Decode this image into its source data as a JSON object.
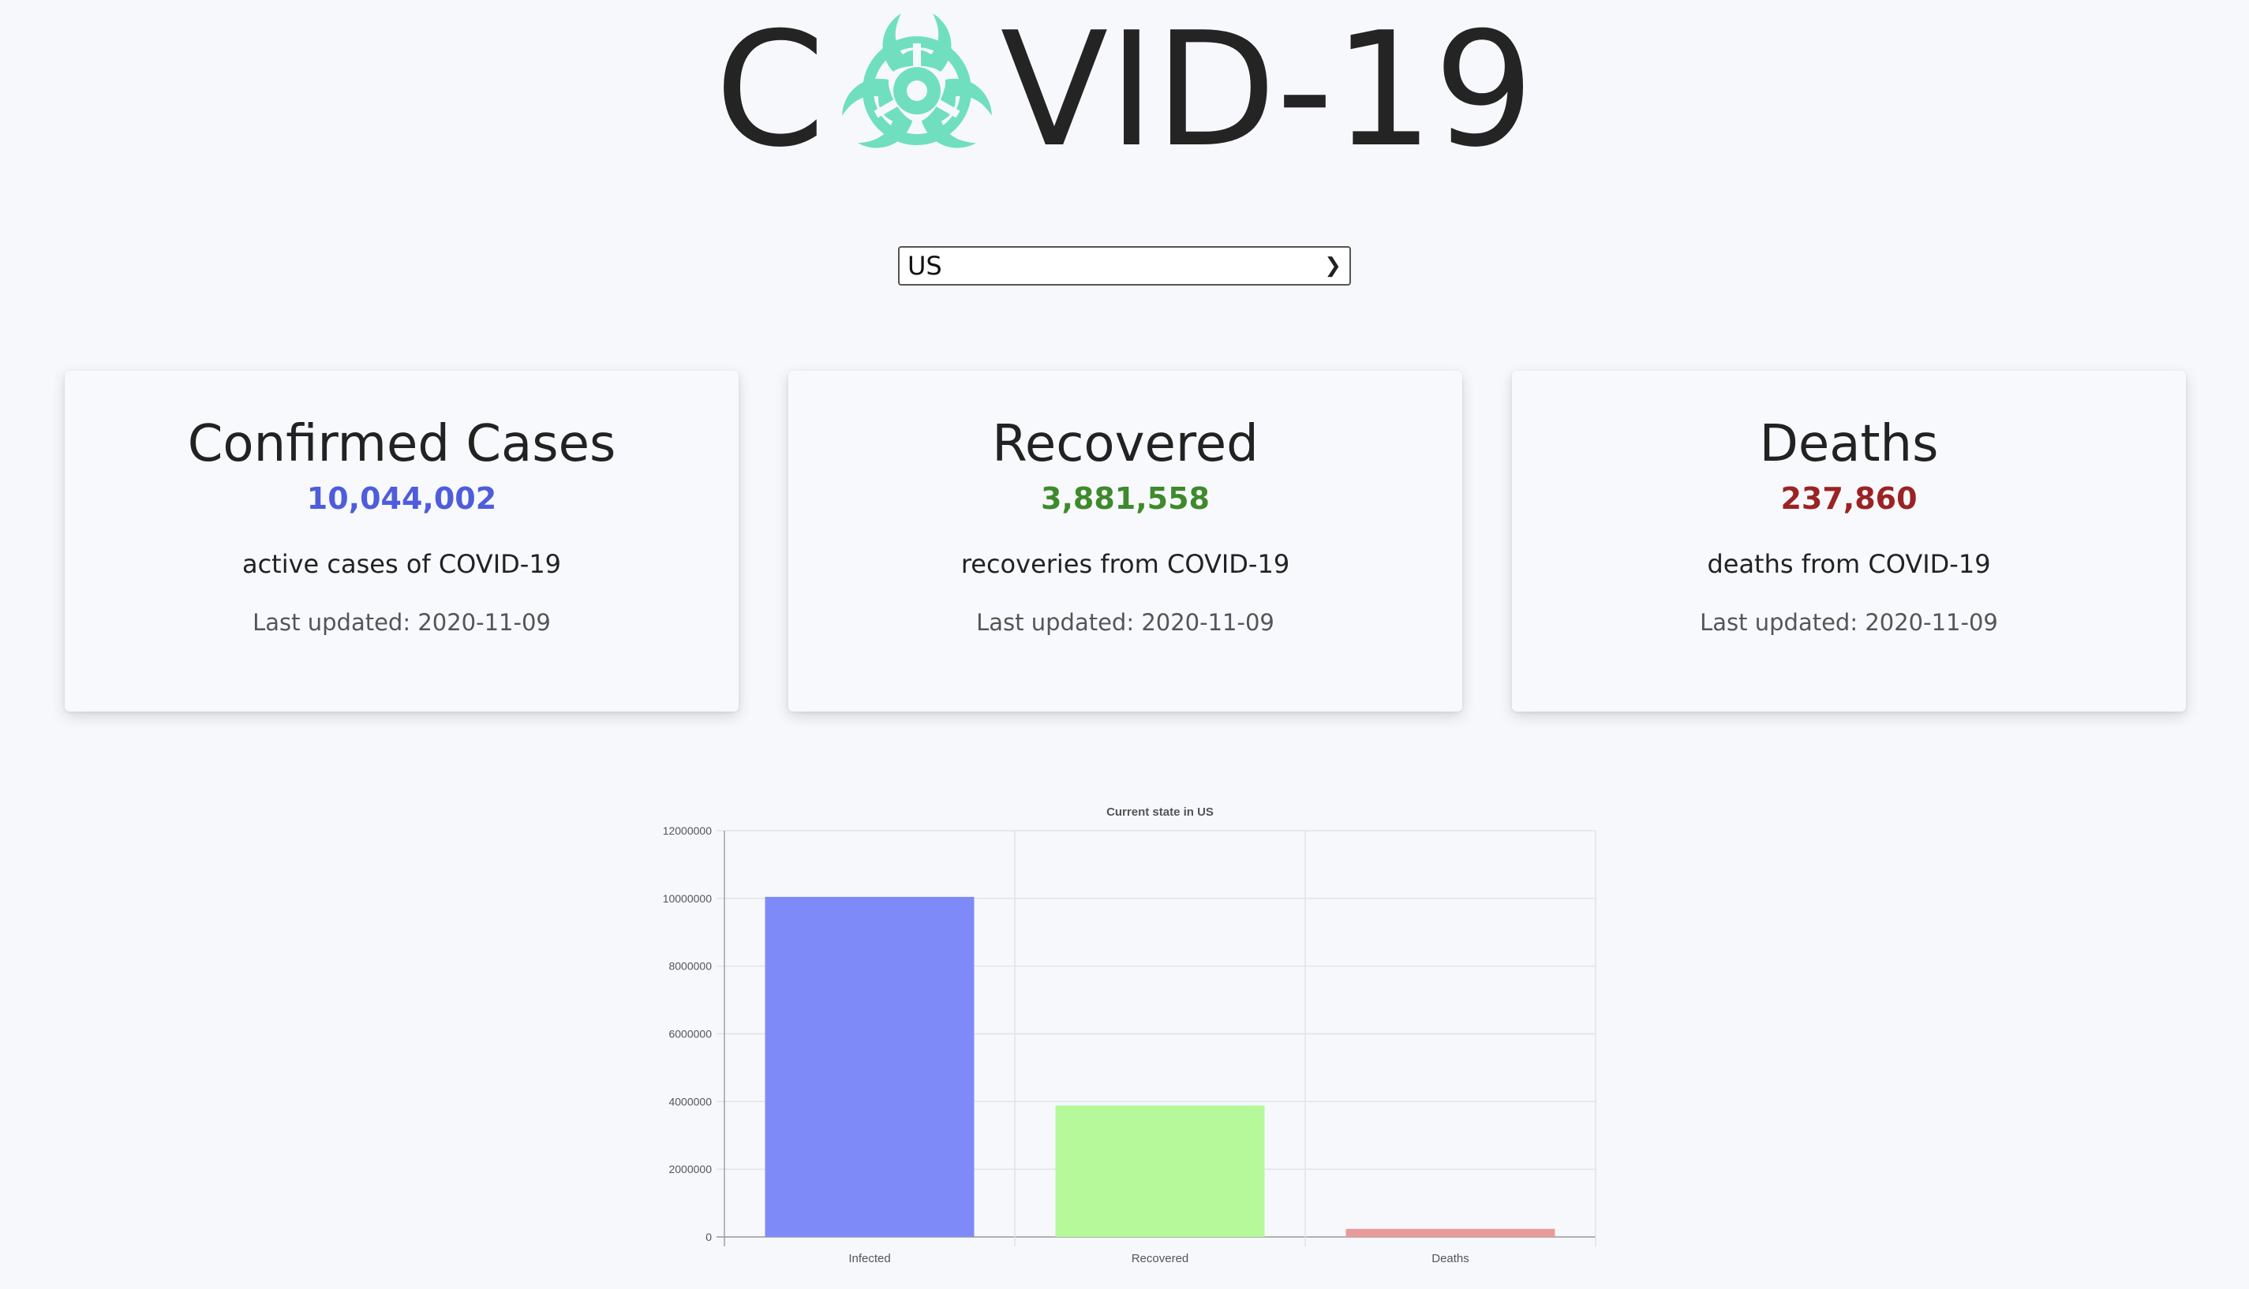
{
  "header": {
    "title_prefix": "C",
    "title_suffix": "VID-19",
    "logo_icon": "biohazard-icon",
    "logo_color": "#6fdfc0"
  },
  "country_select": {
    "selected": "US"
  },
  "cards": [
    {
      "title": "Confirmed Cases",
      "value": "10,044,002",
      "description": "active cases of COVID-19",
      "updated": "Last updated: 2020-11-09",
      "color": "#4e5ddb"
    },
    {
      "title": "Recovered",
      "value": "3,881,558",
      "description": "recoveries from COVID-19",
      "updated": "Last updated: 2020-11-09",
      "color": "#3e8a2c"
    },
    {
      "title": "Deaths",
      "value": "237,860",
      "description": "deaths from COVID-19",
      "updated": "Last updated: 2020-11-09",
      "color": "#9b2323"
    }
  ],
  "chart_data": {
    "type": "bar",
    "title": "Current state in US",
    "categories": [
      "Infected",
      "Recovered",
      "Deaths"
    ],
    "values": [
      10044002,
      3881558,
      237860
    ],
    "colors": [
      "#7f8af9",
      "#b5f99b",
      "#e99a9a"
    ],
    "ylim": [
      0,
      12000000
    ],
    "yticks": [
      "0",
      "2000000",
      "4000000",
      "6000000",
      "8000000",
      "10000000",
      "12000000"
    ],
    "grid": true,
    "legend": "none"
  }
}
